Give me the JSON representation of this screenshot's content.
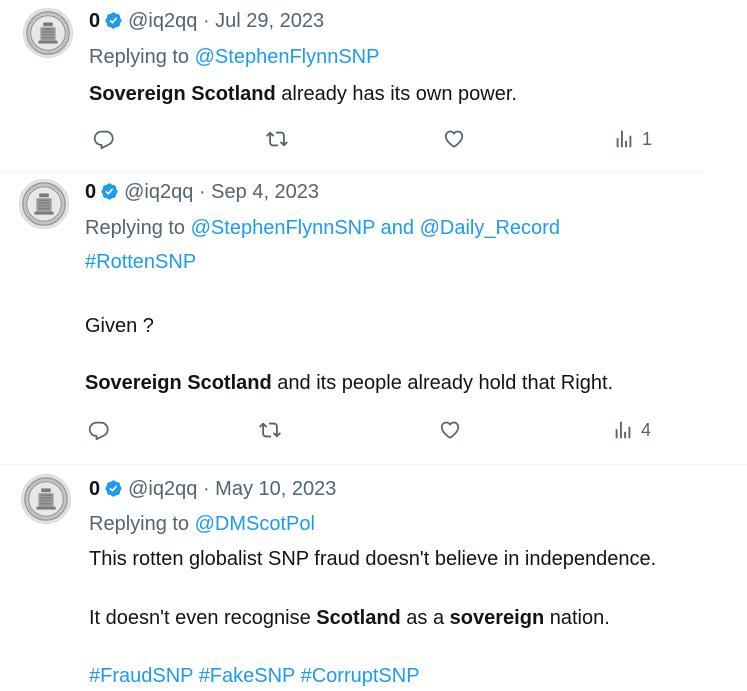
{
  "tweets": [
    {
      "author_name": "0",
      "handle": "@iq2qq",
      "separator": "·",
      "date": "Jul 29, 2023",
      "replying_prefix": "Replying to",
      "replying_to": "@StephenFlynnSNP",
      "body": [
        [
          {
            "text": "Sovereign Scotland",
            "bold": true
          },
          {
            "text": " already has its own power."
          }
        ]
      ],
      "views": "1"
    },
    {
      "author_name": "0",
      "handle": "@iq2qq",
      "separator": "·",
      "date": "Sep 4, 2023",
      "replying_prefix": "Replying to",
      "replying_to": "@StephenFlynnSNP",
      "replying_and": "and",
      "replying_to_2": "@Daily_Record",
      "hashtag_line": "#RottenSNP",
      "body_line_1": "Given ?",
      "body_line_2": [
        {
          "text": "Sovereign Scotland",
          "bold": true
        },
        {
          "text": " and its people already hold that Right."
        }
      ],
      "views": "4"
    },
    {
      "author_name": "0",
      "handle": "@iq2qq",
      "separator": "·",
      "date": "May 10, 2023",
      "replying_prefix": "Replying to",
      "replying_to": "@DMScotPol",
      "body_line_1": "This rotten globalist SNP fraud doesn't believe in independence.",
      "body_line_2": [
        {
          "text": "It doesn't even recognise "
        },
        {
          "text": "Scotland",
          "bold": true
        },
        {
          "text": " as a "
        },
        {
          "text": "sovereign",
          "bold": true
        },
        {
          "text": " nation."
        }
      ],
      "hashtags": "#FraudSNP #FakeSNP #CorruptSNP"
    }
  ],
  "icons": {
    "reply": "reply-icon",
    "retweet": "retweet-icon",
    "like": "like-icon",
    "views": "views-icon",
    "verified": "verified-badge-icon",
    "avatar": "seal-avatar"
  },
  "colors": {
    "link": "#1d9bf0",
    "muted": "#536471",
    "text": "#0f1419",
    "verified": "#1d9bf0"
  }
}
